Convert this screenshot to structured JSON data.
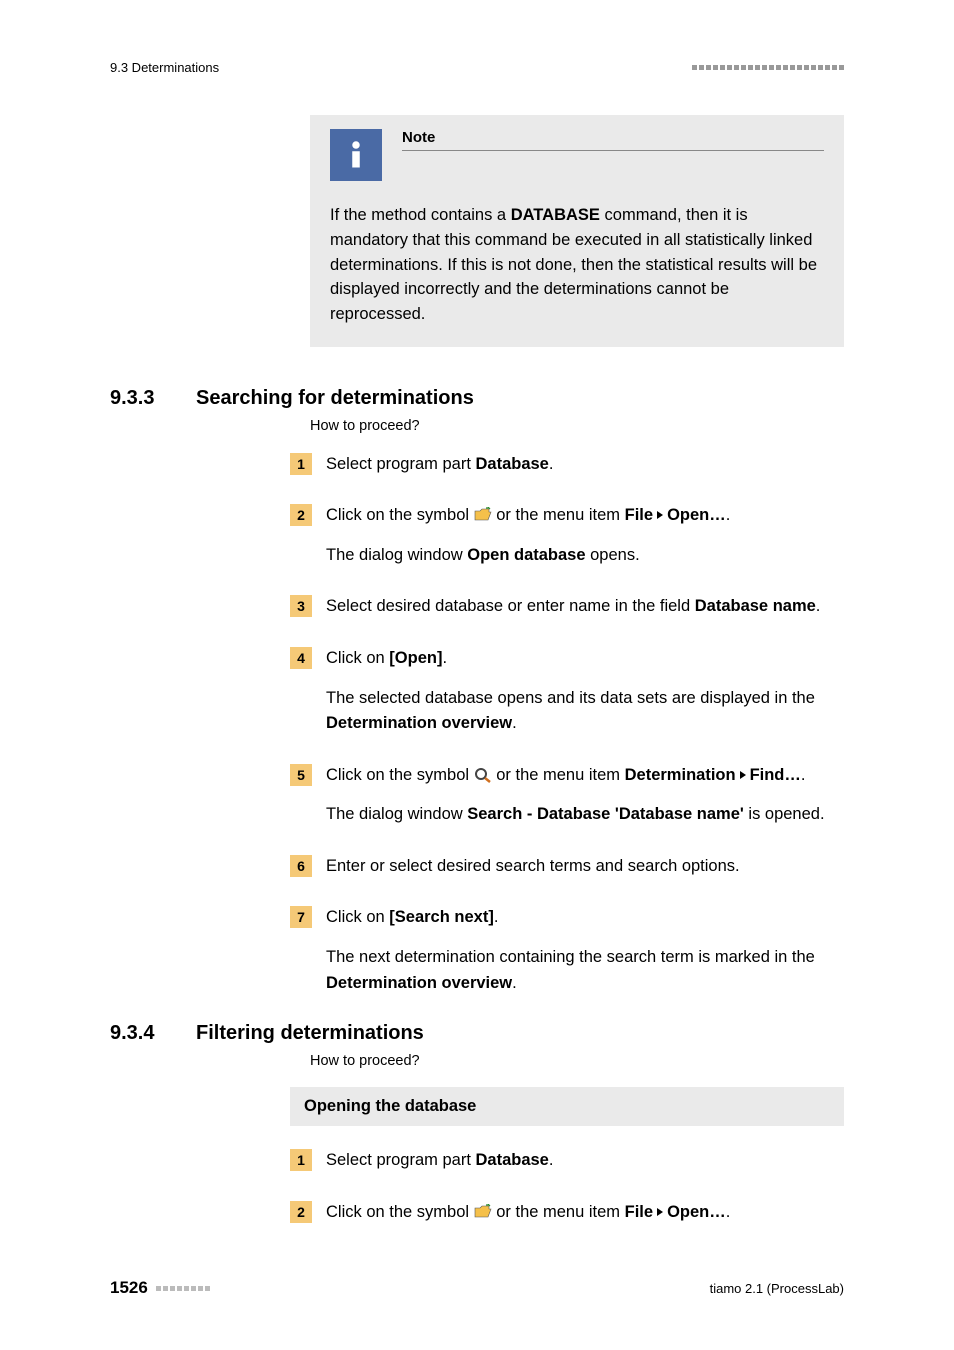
{
  "header": {
    "left": "9.3 Determinations"
  },
  "note": {
    "title": "Note",
    "body_1": "If the method contains a ",
    "body_bold": "DATABASE",
    "body_2": " command, then it is mandatory that this command be executed in all statistically linked determinations. If this is not done, then the statistical results will be displayed incorrectly and the determinations cannot be reprocessed."
  },
  "section933": {
    "num": "9.3.3",
    "title": "Searching for determinations",
    "proceed": "How to proceed?",
    "steps": {
      "s1": {
        "n": "1",
        "a": "Select program part ",
        "b": "Database",
        "c": "."
      },
      "s2": {
        "n": "2",
        "a": "Click on the symbol ",
        "b": " or the menu item ",
        "file": "File",
        "open": "Open…",
        "c": ".",
        "p2a": "The dialog window ",
        "p2b": "Open database",
        "p2c": " opens."
      },
      "s3": {
        "n": "3",
        "a": "Select desired database or enter name in the field ",
        "b": "Database name",
        "c": "."
      },
      "s4": {
        "n": "4",
        "a": "Click on ",
        "b": "[Open]",
        "c": ".",
        "p2a": "The selected database opens and its data sets are displayed in the ",
        "p2b": "Determination overview",
        "p2c": "."
      },
      "s5": {
        "n": "5",
        "a": "Click on the symbol ",
        "b": " or the menu item ",
        "det": "Determination",
        "find": "Find…",
        "c": ".",
        "p2a": "The dialog window ",
        "p2b": "Search - Database 'Database name'",
        "p2c": " is opened."
      },
      "s6": {
        "n": "6",
        "a": "Enter or select desired search terms and search options."
      },
      "s7": {
        "n": "7",
        "a": "Click on ",
        "b": "[Search next]",
        "c": ".",
        "p2a": "The next determination containing the search term is marked in the ",
        "p2b": "Determination overview",
        "p2c": "."
      }
    }
  },
  "section934": {
    "num": "9.3.4",
    "title": "Filtering determinations",
    "proceed": "How to proceed?",
    "subhead": "Opening the database",
    "steps": {
      "s1": {
        "n": "1",
        "a": "Select program part ",
        "b": "Database",
        "c": "."
      },
      "s2": {
        "n": "2",
        "a": "Click on the symbol ",
        "b": " or the menu item ",
        "file": "File",
        "open": "Open…",
        "c": "."
      }
    }
  },
  "footer": {
    "page": "1526",
    "right": "tiamo 2.1 (ProcessLab)"
  }
}
